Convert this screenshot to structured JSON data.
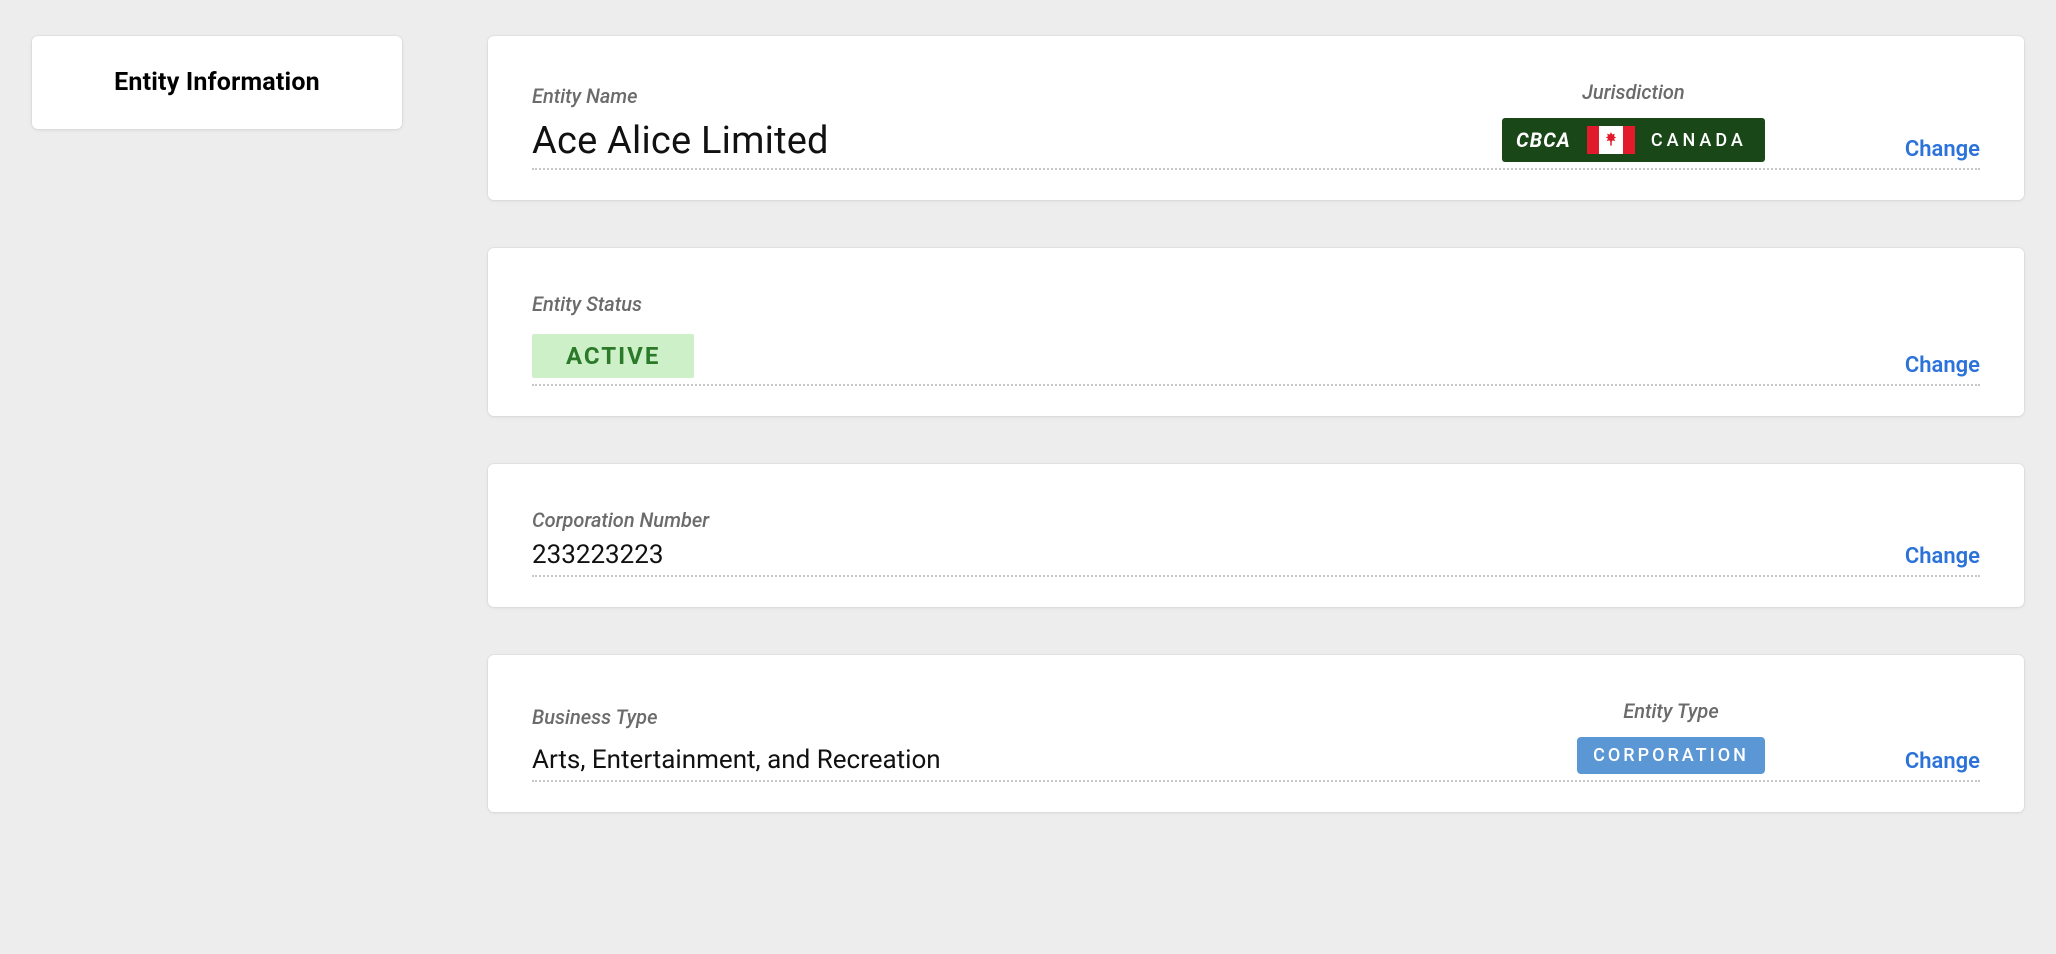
{
  "sidebar": {
    "title": "Entity Information"
  },
  "labels": {
    "entity_name": "Entity Name",
    "jurisdiction": "Jurisdiction",
    "entity_status": "Entity Status",
    "corp_number": "Corporation Number",
    "business_type": "Business Type",
    "entity_type": "Entity Type",
    "change": "Change"
  },
  "entity": {
    "name": "Ace Alice Limited",
    "jurisdiction_code": "CBCA",
    "jurisdiction_country": "CANADA",
    "status": "ACTIVE",
    "corporation_number": "233223223",
    "business_type": "Arts, Entertainment, and Recreation",
    "entity_type": "CORPORATION"
  },
  "colors": {
    "jurisdiction_pill_bg": "#1a4717",
    "status_bg": "#cdf0c8",
    "status_text": "#2a7a2a",
    "type_badge_bg": "#5b97d5",
    "link": "#2b72d9"
  }
}
